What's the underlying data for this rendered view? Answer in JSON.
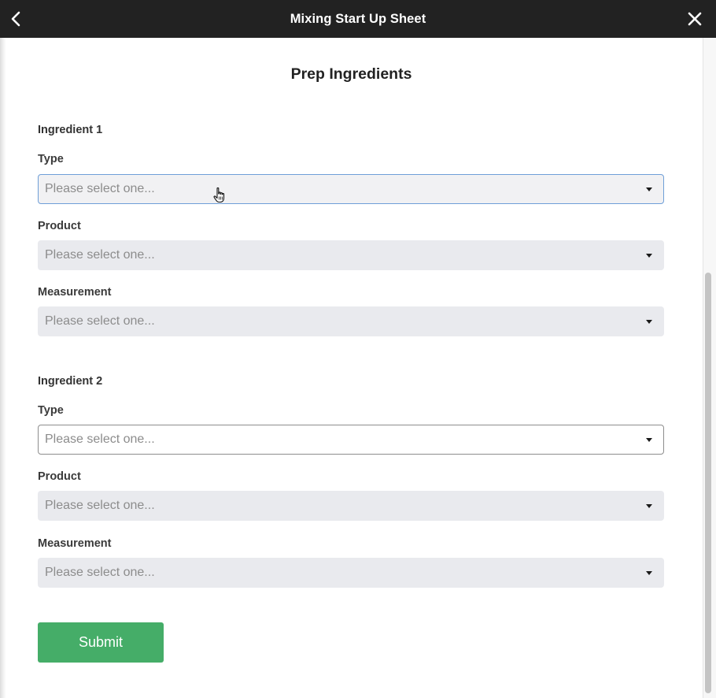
{
  "window": {
    "title": "Mixing Start Up Sheet",
    "back_icon": "chevron-left-icon",
    "close_icon": "close-icon"
  },
  "form": {
    "heading": "Prep Ingredients",
    "ingredients": [
      {
        "label": "Ingredient 1",
        "type_label": "Type",
        "type_placeholder": "Please select one...",
        "product_label": "Product",
        "product_placeholder": "Please select one...",
        "measurement_label": "Measurement",
        "measurement_placeholder": "Please select one..."
      },
      {
        "label": "Ingredient 2",
        "type_label": "Type",
        "type_placeholder": "Please select one...",
        "product_label": "Product",
        "product_placeholder": "Please select one...",
        "measurement_label": "Measurement",
        "measurement_placeholder": "Please select one..."
      }
    ],
    "submit_label": "Submit"
  },
  "colors": {
    "titlebar": "#222222",
    "submit": "#45ad68",
    "focus_border": "#6f9fd8",
    "disabled_field": "#e9eaee"
  }
}
